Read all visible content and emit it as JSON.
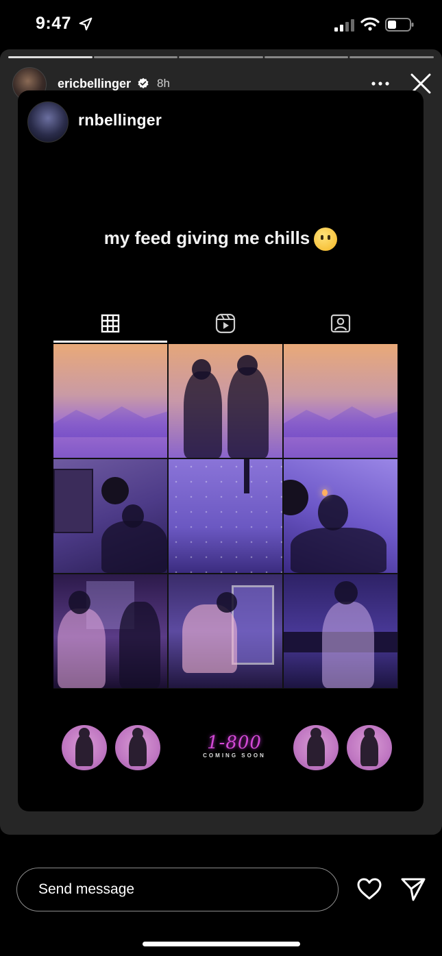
{
  "status_bar": {
    "time": "9:47"
  },
  "story": {
    "username": "ericbellinger",
    "time_ago": "8h",
    "segments": 5
  },
  "shared_post": {
    "username": "rnbellinger",
    "caption": "my feed giving me chills",
    "tabs": [
      "grid-icon",
      "reels-icon",
      "tagged-icon"
    ],
    "highlight_logo": {
      "main": "1-800",
      "sub": "COMING SOON"
    }
  },
  "message_bar": {
    "placeholder": "Send message"
  },
  "colors": {
    "background": "#000000",
    "story_bg": "#262626",
    "accent_pink": "#d44ad6"
  }
}
